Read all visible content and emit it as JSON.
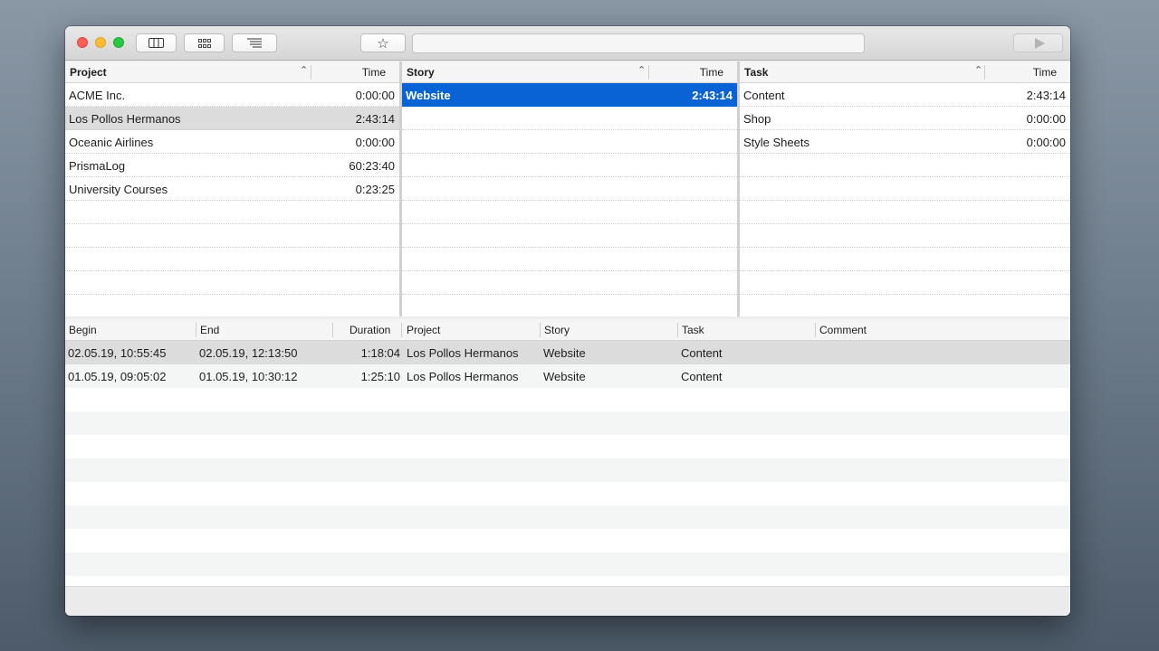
{
  "toolbar": {
    "search_value": "",
    "star_glyph": "☆"
  },
  "projects": {
    "header": {
      "name": "Project",
      "time": "Time"
    },
    "rows": [
      {
        "name": "ACME Inc.",
        "time": "0:00:00"
      },
      {
        "name": "Los Pollos Hermanos",
        "time": "2:43:14"
      },
      {
        "name": "Oceanic Airlines",
        "time": "0:00:00"
      },
      {
        "name": "PrismaLog",
        "time": "60:23:40"
      },
      {
        "name": "University Courses",
        "time": "0:23:25"
      }
    ]
  },
  "stories": {
    "header": {
      "name": "Story",
      "time": "Time"
    },
    "rows": [
      {
        "name": "Website",
        "time": "2:43:14"
      }
    ]
  },
  "tasks": {
    "header": {
      "name": "Task",
      "time": "Time"
    },
    "rows": [
      {
        "name": "Content",
        "time": "2:43:14"
      },
      {
        "name": "Shop",
        "time": "0:00:00"
      },
      {
        "name": "Style Sheets",
        "time": "0:00:00"
      }
    ]
  },
  "log": {
    "columns": [
      "Begin",
      "End",
      "Duration",
      "Project",
      "Story",
      "Task",
      "Comment"
    ],
    "rows": [
      {
        "begin": "02.05.19, 10:55:45",
        "end": "02.05.19, 12:13:50",
        "duration": "1:18:04",
        "project": "Los Pollos Hermanos",
        "story": "Website",
        "task": "Content",
        "comment": ""
      },
      {
        "begin": "01.05.19, 09:05:02",
        "end": "01.05.19, 10:30:12",
        "duration": "1:25:10",
        "project": "Los Pollos Hermanos",
        "story": "Website",
        "task": "Content",
        "comment": ""
      }
    ]
  },
  "colors": {
    "selection_blue": "#0963d4",
    "selection_gray": "#dcdcdc"
  }
}
